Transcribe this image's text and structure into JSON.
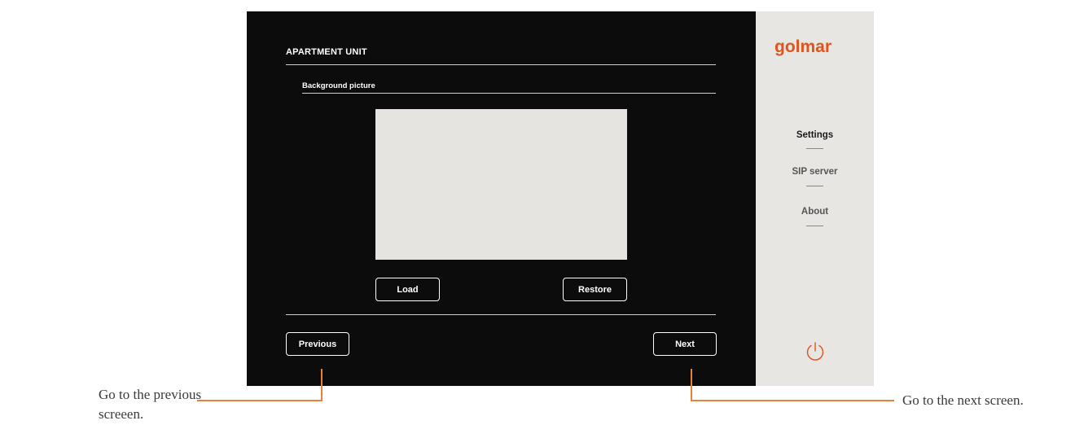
{
  "screen": {
    "title": "APARTMENT UNIT",
    "section": "Background picture",
    "buttons": {
      "load": "Load",
      "restore": "Restore",
      "previous": "Previous",
      "next": "Next"
    }
  },
  "sidebar": {
    "logo_text": "golmar",
    "items": [
      {
        "label": "Settings",
        "active": true
      },
      {
        "label": "SIP server",
        "active": false
      },
      {
        "label": "About",
        "active": false
      }
    ],
    "power_icon": "power-icon"
  },
  "annotations": {
    "previous_line1": "Go to the previous",
    "previous_line2": "screeen.",
    "next": "Go to the next screen."
  },
  "colors": {
    "screen_bg": "#0d0c0c",
    "sidebar_bg": "#e8e6e3",
    "accent": "#e8823a",
    "logo": "#e2541c"
  }
}
